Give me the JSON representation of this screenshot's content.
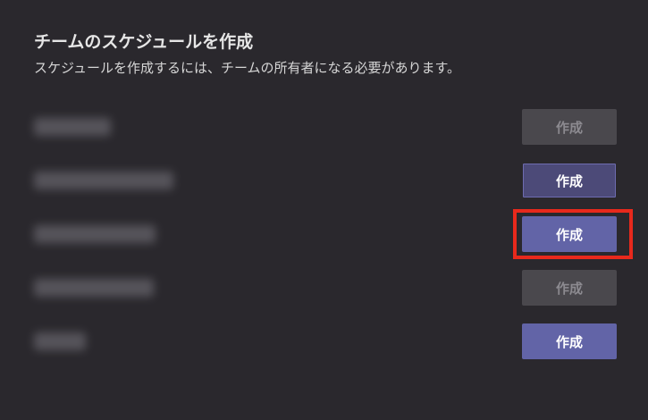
{
  "header": {
    "title": "チームのスケジュールを作成",
    "subtitle": "スケジュールを作成するには、チームの所有者になる必要があります。"
  },
  "teams": [
    {
      "create_label": "作成",
      "state": "disabled"
    },
    {
      "create_label": "作成",
      "state": "hover"
    },
    {
      "create_label": "作成",
      "state": "enabled"
    },
    {
      "create_label": "作成",
      "state": "disabled"
    },
    {
      "create_label": "作成",
      "state": "enabled"
    }
  ],
  "colors": {
    "background": "#2a282d",
    "primary_button": "#6264a7",
    "hover_button": "#4c4a78",
    "disabled_button": "#4a484d",
    "highlight": "#e8291c"
  }
}
